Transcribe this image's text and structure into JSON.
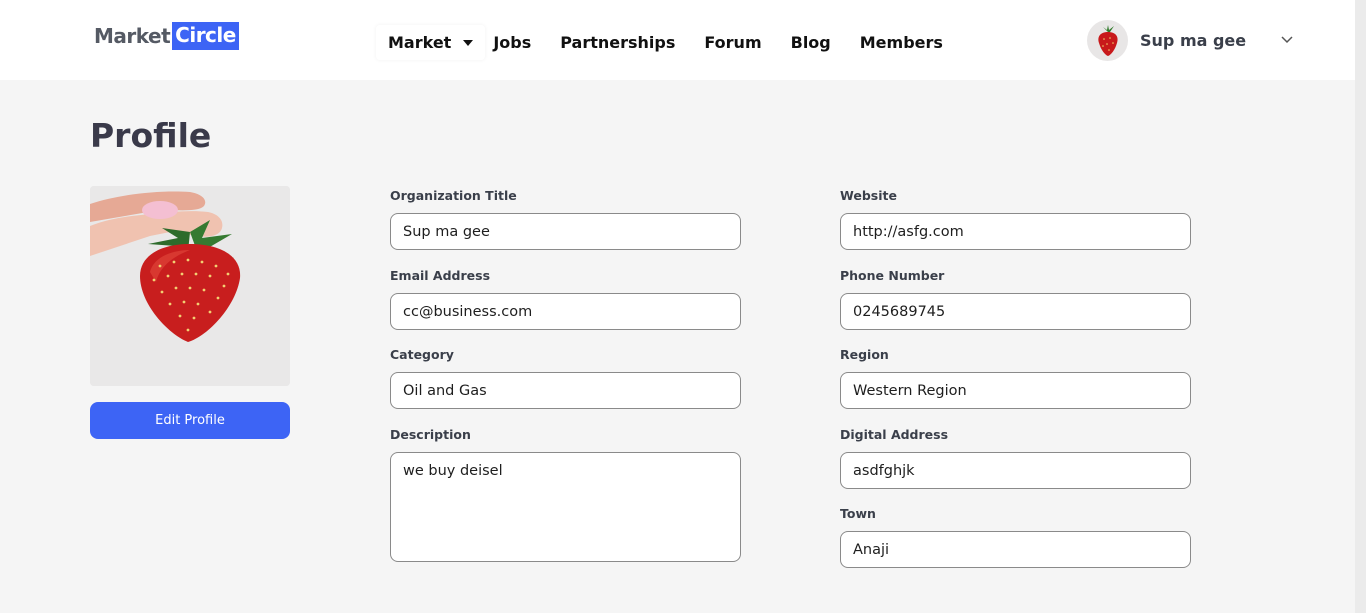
{
  "brand": {
    "part1": "Market",
    "part2": "Circle",
    "accent": "#3d64f5"
  },
  "nav": {
    "market": "Market",
    "jobs": "Jobs",
    "partnerships": "Partnerships",
    "forum": "Forum",
    "blog": "Blog",
    "members": "Members"
  },
  "user": {
    "name": "Sup ma gee",
    "avatar_icon": "strawberry-icon",
    "menu_icon": "chevron-down-icon"
  },
  "page": {
    "title": "Profile"
  },
  "profile": {
    "photo_icon": "strawberry-photo",
    "edit_button": "Edit Profile"
  },
  "form": {
    "org_title": {
      "label": "Organization Title",
      "value": "Sup ma gee"
    },
    "email": {
      "label": "Email Address",
      "value": "cc@business.com"
    },
    "category": {
      "label": "Category",
      "value": "Oil and Gas"
    },
    "description": {
      "label": "Description",
      "value": "we buy deisel"
    },
    "website": {
      "label": "Website",
      "value": "http://asfg.com"
    },
    "phone": {
      "label": "Phone Number",
      "value": "0245689745"
    },
    "region": {
      "label": "Region",
      "value": "Western Region"
    },
    "digital_address": {
      "label": "Digital Address",
      "value": "asdfghjk"
    },
    "town": {
      "label": "Town",
      "value": "Anaji"
    }
  }
}
